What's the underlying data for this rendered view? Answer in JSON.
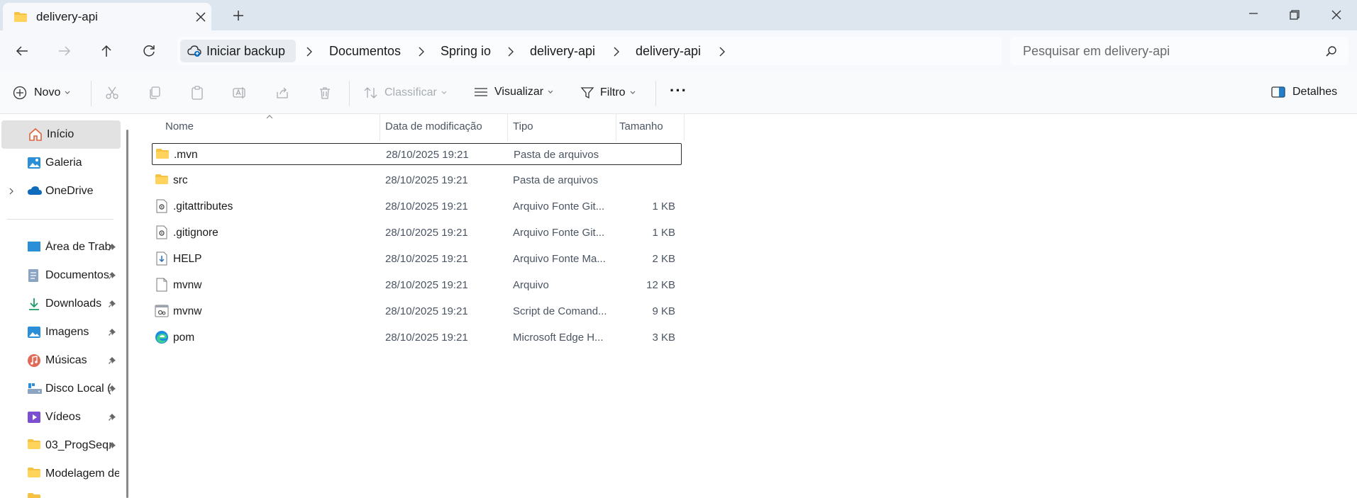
{
  "window": {
    "tab_title": "delivery-api"
  },
  "address": {
    "backup_label": "Iniciar backup",
    "crumbs": [
      "Documentos",
      "Spring io",
      "delivery-api",
      "delivery-api"
    ],
    "search_placeholder": "Pesquisar em delivery-api"
  },
  "toolbar": {
    "new_label": "Novo",
    "sort_label": "Classificar",
    "view_label": "Visualizar",
    "filter_label": "Filtro",
    "more_label": "···",
    "details_label": "Detalhes"
  },
  "sidebar": {
    "items": [
      {
        "label": "Início",
        "icon": "home-icon"
      },
      {
        "label": "Galeria",
        "icon": "gallery-icon"
      },
      {
        "label": "OneDrive",
        "icon": "cloud-icon"
      },
      {
        "label": "Área de Trab",
        "icon": "desktop-icon",
        "pinned": true
      },
      {
        "label": "Documentos",
        "icon": "documents-icon",
        "pinned": true
      },
      {
        "label": "Downloads",
        "icon": "download-icon",
        "pinned": true
      },
      {
        "label": "Imagens",
        "icon": "pictures-icon",
        "pinned": true
      },
      {
        "label": "Músicas",
        "icon": "music-icon",
        "pinned": true
      },
      {
        "label": "Disco Local (",
        "icon": "drive-icon",
        "pinned": true
      },
      {
        "label": "Vídeos",
        "icon": "videos-icon",
        "pinned": true
      },
      {
        "label": "03_ProgSeqı",
        "icon": "folder-icon",
        "pinned": true
      },
      {
        "label": "Modelagem de",
        "icon": "folder-icon",
        "pinned": false
      }
    ]
  },
  "columns": {
    "name": "Nome",
    "modified": "Data de modificação",
    "type": "Tipo",
    "size": "Tamanho"
  },
  "files": [
    {
      "name": ".mvn",
      "date": "28/10/2025 19:21",
      "type": "Pasta de arquivos",
      "size": "",
      "icon": "folder-icon"
    },
    {
      "name": "src",
      "date": "28/10/2025 19:21",
      "type": "Pasta de arquivos",
      "size": "",
      "icon": "folder-icon"
    },
    {
      "name": ".gitattributes",
      "date": "28/10/2025 19:21",
      "type": "Arquivo Fonte Git...",
      "size": "1 KB",
      "icon": "settings-file-icon"
    },
    {
      "name": ".gitignore",
      "date": "28/10/2025 19:21",
      "type": "Arquivo Fonte Git...",
      "size": "1 KB",
      "icon": "settings-file-icon"
    },
    {
      "name": "HELP",
      "date": "28/10/2025 19:21",
      "type": "Arquivo Fonte Ma...",
      "size": "2 KB",
      "icon": "markdown-file-icon"
    },
    {
      "name": "mvnw",
      "date": "28/10/2025 19:21",
      "type": "Arquivo",
      "size": "12 KB",
      "icon": "file-icon"
    },
    {
      "name": "mvnw",
      "date": "28/10/2025 19:21",
      "type": "Script de Comand...",
      "size": "9 KB",
      "icon": "script-file-icon"
    },
    {
      "name": "pom",
      "date": "28/10/2025 19:21",
      "type": "Microsoft Edge H...",
      "size": "3 KB",
      "icon": "edge-icon"
    }
  ],
  "colors": {
    "folder": "#f5c242",
    "accent": "#0067c0",
    "selected_bg": "#e2e2e2"
  }
}
